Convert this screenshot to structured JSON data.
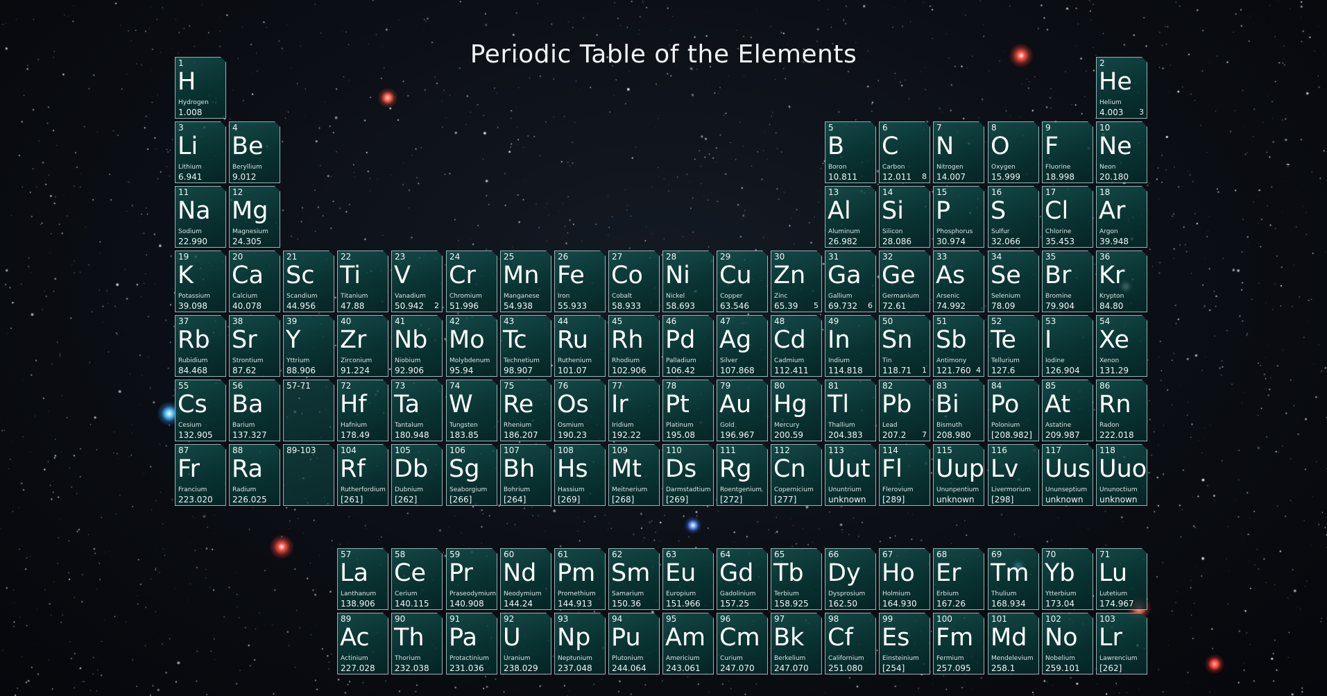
{
  "title": "Periodic Table of the Elements",
  "colors": {
    "cell_fill": "#0b4a47",
    "cell_border": "#bfe1e1",
    "text": "#ffffff"
  },
  "elements": [
    {
      "n": "1",
      "s": "H",
      "name": "Hydrogen",
      "m": "1.008",
      "r": 1,
      "c": 1
    },
    {
      "n": "2",
      "s": "He",
      "name": "Helium",
      "m": "4.003",
      "p": "3",
      "r": 1,
      "c": 18
    },
    {
      "n": "3",
      "s": "Li",
      "name": "Lithium",
      "m": "6.941",
      "r": 2,
      "c": 1
    },
    {
      "n": "4",
      "s": "Be",
      "name": "Beryllium",
      "m": "9.012",
      "r": 2,
      "c": 2
    },
    {
      "n": "5",
      "s": "B",
      "name": "Boron",
      "m": "10.811",
      "r": 2,
      "c": 13
    },
    {
      "n": "6",
      "s": "C",
      "name": "Carbon",
      "m": "12.011",
      "p": "8",
      "r": 2,
      "c": 14
    },
    {
      "n": "7",
      "s": "N",
      "name": "Nitrogen",
      "m": "14.007",
      "r": 2,
      "c": 15
    },
    {
      "n": "8",
      "s": "O",
      "name": "Oxygen",
      "m": "15.999",
      "r": 2,
      "c": 16
    },
    {
      "n": "9",
      "s": "F",
      "name": "Fluorine",
      "m": "18.998",
      "r": 2,
      "c": 17
    },
    {
      "n": "10",
      "s": "Ne",
      "name": "Neon",
      "m": "20.180",
      "r": 2,
      "c": 18
    },
    {
      "n": "11",
      "s": "Na",
      "name": "Sodium",
      "m": "22.990",
      "r": 3,
      "c": 1
    },
    {
      "n": "12",
      "s": "Mg",
      "name": "Magnesium",
      "m": "24.305",
      "r": 3,
      "c": 2
    },
    {
      "n": "13",
      "s": "Al",
      "name": "Aluminum",
      "m": "26.982",
      "r": 3,
      "c": 13
    },
    {
      "n": "14",
      "s": "Si",
      "name": "Silicon",
      "m": "28.086",
      "r": 3,
      "c": 14
    },
    {
      "n": "15",
      "s": "P",
      "name": "Phosphorus",
      "m": "30.974",
      "r": 3,
      "c": 15
    },
    {
      "n": "16",
      "s": "S",
      "name": "Sulfur",
      "m": "32.066",
      "r": 3,
      "c": 16
    },
    {
      "n": "17",
      "s": "Cl",
      "name": "Chlorine",
      "m": "35.453",
      "r": 3,
      "c": 17
    },
    {
      "n": "18",
      "s": "Ar",
      "name": "Argon",
      "m": "39.948",
      "r": 3,
      "c": 18
    },
    {
      "n": "19",
      "s": "K",
      "name": "Potassium",
      "m": "39.098",
      "r": 4,
      "c": 1
    },
    {
      "n": "20",
      "s": "Ca",
      "name": "Calcium",
      "m": "40.078",
      "r": 4,
      "c": 2
    },
    {
      "n": "21",
      "s": "Sc",
      "name": "Scandium",
      "m": "44.956",
      "r": 4,
      "c": 3
    },
    {
      "n": "22",
      "s": "Ti",
      "name": "Titanium",
      "m": "47.88",
      "r": 4,
      "c": 4
    },
    {
      "n": "23",
      "s": "V",
      "name": "Vanadium",
      "m": "50.942",
      "p": "2",
      "r": 4,
      "c": 5
    },
    {
      "n": "24",
      "s": "Cr",
      "name": "Chromium",
      "m": "51.996",
      "r": 4,
      "c": 6
    },
    {
      "n": "25",
      "s": "Mn",
      "name": "Manganese",
      "m": "54.938",
      "r": 4,
      "c": 7
    },
    {
      "n": "26",
      "s": "Fe",
      "name": "Iron",
      "m": "55.933",
      "r": 4,
      "c": 8
    },
    {
      "n": "27",
      "s": "Co",
      "name": "Cobalt",
      "m": "58.933",
      "r": 4,
      "c": 9
    },
    {
      "n": "28",
      "s": "Ni",
      "name": "Nickel",
      "m": "58.693",
      "r": 4,
      "c": 10
    },
    {
      "n": "29",
      "s": "Cu",
      "name": "Copper",
      "m": "63.546",
      "r": 4,
      "c": 11
    },
    {
      "n": "30",
      "s": "Zn",
      "name": "Zinc",
      "m": "65.39",
      "p": "5",
      "r": 4,
      "c": 12
    },
    {
      "n": "31",
      "s": "Ga",
      "name": "Gallium",
      "m": "69.732",
      "p": "6",
      "r": 4,
      "c": 13
    },
    {
      "n": "32",
      "s": "Ge",
      "name": "Germanium",
      "m": "72.61",
      "r": 4,
      "c": 14
    },
    {
      "n": "33",
      "s": "As",
      "name": "Arsenic",
      "m": "74.992",
      "r": 4,
      "c": 15
    },
    {
      "n": "34",
      "s": "Se",
      "name": "Selenium",
      "m": "78.09",
      "r": 4,
      "c": 16
    },
    {
      "n": "35",
      "s": "Br",
      "name": "Bromine",
      "m": "79.904",
      "r": 4,
      "c": 17
    },
    {
      "n": "36",
      "s": "Kr",
      "name": "Krypton",
      "m": "84.80",
      "r": 4,
      "c": 18
    },
    {
      "n": "37",
      "s": "Rb",
      "name": "Rubidium",
      "m": "84.468",
      "r": 5,
      "c": 1
    },
    {
      "n": "38",
      "s": "Sr",
      "name": "Strontium",
      "m": "87.62",
      "r": 5,
      "c": 2
    },
    {
      "n": "39",
      "s": "Y",
      "name": "Yttrium",
      "m": "88.906",
      "r": 5,
      "c": 3
    },
    {
      "n": "40",
      "s": "Zr",
      "name": "Zirconium",
      "m": "91.224",
      "r": 5,
      "c": 4
    },
    {
      "n": "41",
      "s": "Nb",
      "name": "Niobium",
      "m": "92.906",
      "r": 5,
      "c": 5
    },
    {
      "n": "42",
      "s": "Mo",
      "name": "Molybdenum",
      "m": "95.94",
      "r": 5,
      "c": 6
    },
    {
      "n": "43",
      "s": "Tc",
      "name": "Technetium",
      "m": "98.907",
      "r": 5,
      "c": 7
    },
    {
      "n": "44",
      "s": "Ru",
      "name": "Ruthenium",
      "m": "101.07",
      "r": 5,
      "c": 8
    },
    {
      "n": "45",
      "s": "Rh",
      "name": "Rhodium",
      "m": "102.906",
      "r": 5,
      "c": 9
    },
    {
      "n": "46",
      "s": "Pd",
      "name": "Palladium",
      "m": "106.42",
      "r": 5,
      "c": 10
    },
    {
      "n": "47",
      "s": "Ag",
      "name": "Silver",
      "m": "107.868",
      "r": 5,
      "c": 11
    },
    {
      "n": "48",
      "s": "Cd",
      "name": "Cadmium",
      "m": "112.411",
      "r": 5,
      "c": 12
    },
    {
      "n": "49",
      "s": "In",
      "name": "Indium",
      "m": "114.818",
      "r": 5,
      "c": 13
    },
    {
      "n": "50",
      "s": "Sn",
      "name": "Tin",
      "m": "118.71",
      "p": "1",
      "r": 5,
      "c": 14
    },
    {
      "n": "51",
      "s": "Sb",
      "name": "Antimony",
      "m": "121.760",
      "p": "4",
      "r": 5,
      "c": 15
    },
    {
      "n": "52",
      "s": "Te",
      "name": "Tellurium",
      "m": "127.6",
      "r": 5,
      "c": 16
    },
    {
      "n": "53",
      "s": "I",
      "name": "Iodine",
      "m": "126.904",
      "r": 5,
      "c": 17
    },
    {
      "n": "54",
      "s": "Xe",
      "name": "Xenon",
      "m": "131.29",
      "r": 5,
      "c": 18
    },
    {
      "n": "55",
      "s": "Cs",
      "name": "Cesium",
      "m": "132.905",
      "r": 6,
      "c": 1
    },
    {
      "n": "56",
      "s": "Ba",
      "name": "Barium",
      "m": "137.327",
      "r": 6,
      "c": 2
    },
    {
      "n": "57-71",
      "s": "",
      "name": "",
      "m": "",
      "r": 6,
      "c": 3
    },
    {
      "n": "72",
      "s": "Hf",
      "name": "Hafnium",
      "m": "178.49",
      "r": 6,
      "c": 4
    },
    {
      "n": "73",
      "s": "Ta",
      "name": "Tantalum",
      "m": "180.948",
      "r": 6,
      "c": 5
    },
    {
      "n": "74",
      "s": "W",
      "name": "Tungsten",
      "m": "183.85",
      "r": 6,
      "c": 6
    },
    {
      "n": "75",
      "s": "Re",
      "name": "Rhenium",
      "m": "186.207",
      "r": 6,
      "c": 7
    },
    {
      "n": "76",
      "s": "Os",
      "name": "Osmium",
      "m": "190.23",
      "r": 6,
      "c": 8
    },
    {
      "n": "77",
      "s": "Ir",
      "name": "Iridium",
      "m": "192.22",
      "r": 6,
      "c": 9
    },
    {
      "n": "78",
      "s": "Pt",
      "name": "Platinum",
      "m": "195.08",
      "r": 6,
      "c": 10
    },
    {
      "n": "79",
      "s": "Au",
      "name": "Gold",
      "m": "196.967",
      "r": 6,
      "c": 11
    },
    {
      "n": "80",
      "s": "Hg",
      "name": "Mercury",
      "m": "200.59",
      "r": 6,
      "c": 12
    },
    {
      "n": "81",
      "s": "Tl",
      "name": "Thallium",
      "m": "204.383",
      "r": 6,
      "c": 13
    },
    {
      "n": "82",
      "s": "Pb",
      "name": "Lead",
      "m": "207.2",
      "p": "7",
      "r": 6,
      "c": 14
    },
    {
      "n": "83",
      "s": "Bi",
      "name": "Bismuth",
      "m": "208.980",
      "r": 6,
      "c": 15
    },
    {
      "n": "84",
      "s": "Po",
      "name": "Polonium",
      "m": "[208.982]",
      "r": 6,
      "c": 16
    },
    {
      "n": "85",
      "s": "At",
      "name": "Astatine",
      "m": "209.987",
      "r": 6,
      "c": 17
    },
    {
      "n": "86",
      "s": "Rn",
      "name": "Radon",
      "m": "222.018",
      "r": 6,
      "c": 18
    },
    {
      "n": "87",
      "s": "Fr",
      "name": "Francium",
      "m": "223.020",
      "r": 7,
      "c": 1
    },
    {
      "n": "88",
      "s": "Ra",
      "name": "Radium",
      "m": "226.025",
      "r": 7,
      "c": 2
    },
    {
      "n": "89-103",
      "s": "",
      "name": "",
      "m": "",
      "r": 7,
      "c": 3
    },
    {
      "n": "104",
      "s": "Rf",
      "name": "Rutherfordium",
      "m": "[261]",
      "r": 7,
      "c": 4
    },
    {
      "n": "105",
      "s": "Db",
      "name": "Dubnium",
      "m": "[262]",
      "r": 7,
      "c": 5
    },
    {
      "n": "106",
      "s": "Sg",
      "name": "Seaborgium",
      "m": "[266]",
      "r": 7,
      "c": 6
    },
    {
      "n": "107",
      "s": "Bh",
      "name": "Bohrium",
      "m": "[264]",
      "r": 7,
      "c": 7
    },
    {
      "n": "108",
      "s": "Hs",
      "name": "Hassium",
      "m": "[269]",
      "r": 7,
      "c": 8
    },
    {
      "n": "109",
      "s": "Mt",
      "name": "Meitnerium",
      "m": "[268]",
      "r": 7,
      "c": 9
    },
    {
      "n": "110",
      "s": "Ds",
      "name": "Darmstadtium",
      "m": "[269]",
      "r": 7,
      "c": 10
    },
    {
      "n": "111",
      "s": "Rg",
      "name": "Roentgenium",
      "m": "[272]",
      "r": 7,
      "c": 11
    },
    {
      "n": "112",
      "s": "Cn",
      "name": "Copernicium",
      "m": "[277]",
      "r": 7,
      "c": 12
    },
    {
      "n": "113",
      "s": "Uut",
      "name": "Ununtrium",
      "m": "unknown",
      "r": 7,
      "c": 13
    },
    {
      "n": "114",
      "s": "Fl",
      "name": "Flerovium",
      "m": "[289]",
      "r": 7,
      "c": 14
    },
    {
      "n": "115",
      "s": "Uup",
      "name": "Ununpentium",
      "m": "unknown",
      "r": 7,
      "c": 15
    },
    {
      "n": "116",
      "s": "Lv",
      "name": "Livermorium",
      "m": "[298]",
      "r": 7,
      "c": 16
    },
    {
      "n": "117",
      "s": "Uus",
      "name": "Ununseptium",
      "m": "unknown",
      "r": 7,
      "c": 17
    },
    {
      "n": "118",
      "s": "Uuo",
      "name": "Ununoctium",
      "m": "unknown",
      "r": 7,
      "c": 18
    },
    {
      "n": "57",
      "s": "La",
      "name": "Lanthanum",
      "m": "138.906",
      "r": 9,
      "c": 4
    },
    {
      "n": "58",
      "s": "Ce",
      "name": "Cerium",
      "m": "140.115",
      "r": 9,
      "c": 5
    },
    {
      "n": "59",
      "s": "Pr",
      "name": "Praseodymium",
      "m": "140.908",
      "r": 9,
      "c": 6
    },
    {
      "n": "60",
      "s": "Nd",
      "name": "Neodymium",
      "m": "144.24",
      "r": 9,
      "c": 7
    },
    {
      "n": "61",
      "s": "Pm",
      "name": "Promethium",
      "m": "144.913",
      "r": 9,
      "c": 8
    },
    {
      "n": "62",
      "s": "Sm",
      "name": "Samarium",
      "m": "150.36",
      "r": 9,
      "c": 9
    },
    {
      "n": "63",
      "s": "Eu",
      "name": "Europium",
      "m": "151.966",
      "r": 9,
      "c": 10
    },
    {
      "n": "64",
      "s": "Gd",
      "name": "Gadolinium",
      "m": "157.25",
      "r": 9,
      "c": 11
    },
    {
      "n": "65",
      "s": "Tb",
      "name": "Terbium",
      "m": "158.925",
      "r": 9,
      "c": 12
    },
    {
      "n": "66",
      "s": "Dy",
      "name": "Dysprosium",
      "m": "162.50",
      "r": 9,
      "c": 13
    },
    {
      "n": "67",
      "s": "Ho",
      "name": "Holmium",
      "m": "164.930",
      "r": 9,
      "c": 14
    },
    {
      "n": "68",
      "s": "Er",
      "name": "Erbium",
      "m": "167.26",
      "r": 9,
      "c": 15
    },
    {
      "n": "69",
      "s": "Tm",
      "name": "Thulium",
      "m": "168.934",
      "r": 9,
      "c": 16
    },
    {
      "n": "70",
      "s": "Yb",
      "name": "Ytterbium",
      "m": "173.04",
      "r": 9,
      "c": 17
    },
    {
      "n": "71",
      "s": "Lu",
      "name": "Lutetium",
      "m": "174.967",
      "r": 9,
      "c": 18
    },
    {
      "n": "89",
      "s": "Ac",
      "name": "Actinium",
      "m": "227.028",
      "r": 10,
      "c": 4
    },
    {
      "n": "90",
      "s": "Th",
      "name": "Thorium",
      "m": "232.038",
      "r": 10,
      "c": 5
    },
    {
      "n": "91",
      "s": "Pa",
      "name": "Protactinium",
      "m": "231.036",
      "r": 10,
      "c": 6
    },
    {
      "n": "92",
      "s": "U",
      "name": "Uranium",
      "m": "238.029",
      "r": 10,
      "c": 7
    },
    {
      "n": "93",
      "s": "Np",
      "name": "Neptunium",
      "m": "237.048",
      "r": 10,
      "c": 8
    },
    {
      "n": "94",
      "s": "Pu",
      "name": "Plutonium",
      "m": "244.064",
      "r": 10,
      "c": 9
    },
    {
      "n": "95",
      "s": "Am",
      "name": "Americium",
      "m": "243.061",
      "r": 10,
      "c": 10
    },
    {
      "n": "96",
      "s": "Cm",
      "name": "Curium",
      "m": "247.070",
      "r": 10,
      "c": 11
    },
    {
      "n": "97",
      "s": "Bk",
      "name": "Berkelium",
      "m": "247.070",
      "r": 10,
      "c": 12
    },
    {
      "n": "98",
      "s": "Cf",
      "name": "Californium",
      "m": "251.080",
      "r": 10,
      "c": 13
    },
    {
      "n": "99",
      "s": "Es",
      "name": "Einsteinium",
      "m": "[254]",
      "r": 10,
      "c": 14
    },
    {
      "n": "100",
      "s": "Fm",
      "name": "Fermium",
      "m": "257.095",
      "r": 10,
      "c": 15
    },
    {
      "n": "101",
      "s": "Md",
      "name": "Mendelevium",
      "m": "258.1",
      "r": 10,
      "c": 16
    },
    {
      "n": "102",
      "s": "No",
      "name": "Nobelium",
      "m": "259.101",
      "r": 10,
      "c": 17
    },
    {
      "n": "103",
      "s": "Lr",
      "name": "Lawrencium",
      "m": "[262]",
      "r": 10,
      "c": 18
    }
  ]
}
